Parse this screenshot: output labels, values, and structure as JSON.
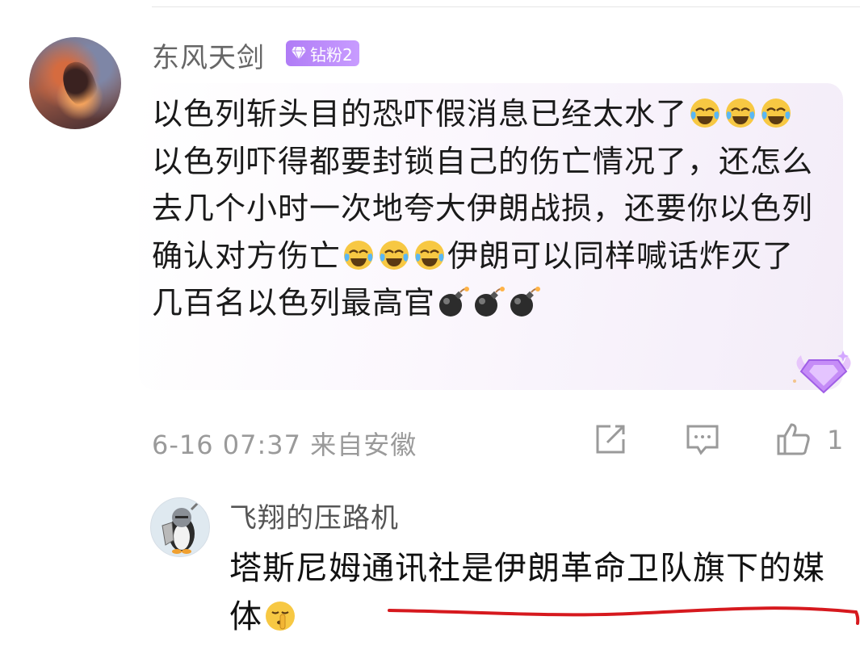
{
  "comment": {
    "username": "东风天剑",
    "badge_label": "钻粉2",
    "text_segments": [
      "以色列斩头目的恐吓假消息已经太水了",
      "以色列吓得都要封锁自己的伤亡情况了，还怎么去几个小时一次地夸大伊朗战损，还要你以色列确认对方伤亡",
      "伊朗可以同样喊话炸灭了几百名以色列最高官"
    ],
    "emojis": [
      "laugh-cry-emoji",
      "laugh-cry-emoji",
      "laugh-cry-emoji",
      "laugh-cry-emoji",
      "laugh-cry-emoji",
      "laugh-cry-emoji",
      "bomb-emoji",
      "bomb-emoji",
      "bomb-emoji"
    ],
    "timestamp": "6-16 07:37",
    "location": "来自安徽",
    "like_count": "1"
  },
  "reply": {
    "username": "飞翔的压路机",
    "text": "塔斯尼姆通讯社是伊朗革命卫队旗下的媒体",
    "emoji": "shush-emoji"
  },
  "colors": {
    "badge": "#b07cf6",
    "annotation_line": "#d6191e"
  }
}
